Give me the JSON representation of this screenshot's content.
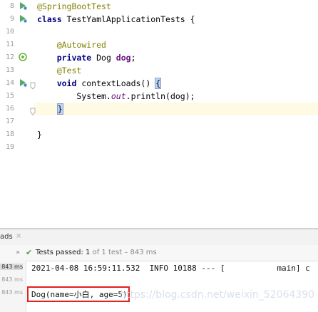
{
  "editor": {
    "lines": [
      {
        "num": "8",
        "icon": "run",
        "parts": [
          {
            "t": "@SpringBootTest",
            "c": "ann"
          }
        ]
      },
      {
        "num": "9",
        "icon": "run",
        "parts": [
          {
            "t": "class ",
            "c": "kw"
          },
          {
            "t": "TestYamlApplicationTests {",
            "c": ""
          }
        ]
      },
      {
        "num": "10",
        "icon": "",
        "parts": []
      },
      {
        "num": "11",
        "icon": "",
        "parts": [
          {
            "t": "    ",
            "c": ""
          },
          {
            "t": "@Autowired",
            "c": "ann"
          }
        ]
      },
      {
        "num": "12",
        "icon": "bean",
        "parts": [
          {
            "t": "    ",
            "c": ""
          },
          {
            "t": "private ",
            "c": "kw"
          },
          {
            "t": "Dog ",
            "c": ""
          },
          {
            "t": "dog",
            "c": "fld"
          },
          {
            "t": ";",
            "c": ""
          }
        ]
      },
      {
        "num": "13",
        "icon": "",
        "parts": [
          {
            "t": "    ",
            "c": ""
          },
          {
            "t": "@Test",
            "c": "ann"
          }
        ]
      },
      {
        "num": "14",
        "icon": "run",
        "parts": [
          {
            "t": "    ",
            "c": ""
          },
          {
            "t": "void ",
            "c": "kw"
          },
          {
            "t": "contextLoads() ",
            "c": ""
          },
          {
            "t": "{",
            "c": "brace"
          }
        ]
      },
      {
        "num": "15",
        "icon": "",
        "parts": [
          {
            "t": "        System.",
            "c": ""
          },
          {
            "t": "out",
            "c": "it"
          },
          {
            "t": ".println(dog);",
            "c": ""
          }
        ]
      },
      {
        "num": "16",
        "icon": "",
        "parts": [
          {
            "t": "    ",
            "c": ""
          },
          {
            "t": "}",
            "c": "brace-caret"
          }
        ]
      },
      {
        "num": "17",
        "icon": "",
        "parts": []
      },
      {
        "num": "18",
        "icon": "",
        "parts": [
          {
            "t": "}",
            "c": ""
          }
        ]
      },
      {
        "num": "19",
        "icon": "",
        "parts": []
      }
    ]
  },
  "run_panel": {
    "tab_label": "ads",
    "tab_close": "×",
    "toolbar_chevron": "»",
    "check_glyph": "✔",
    "tests_passed_label": "Tests passed:",
    "tests_passed_count": "1",
    "tests_passed_detail": "of 1 test – 843 ms"
  },
  "durations": [
    "843 ms",
    "843 ms",
    "843 ms"
  ],
  "console": {
    "log_line": "2021-04-08 16:59:11.532  INFO 10188 --- [           main] c",
    "result_line": "Dog(name=小白, age=5)"
  },
  "watermark": "https://blog.csdn.net/weixin_52064390",
  "colors": {
    "annotation": "#808000",
    "keyword": "#000080",
    "field": "#660e7a",
    "passed": "#4aa53b",
    "highlight_box": "#e12020"
  },
  "icons": {
    "run": "run-gutter-icon",
    "bean": "spring-bean-icon"
  }
}
